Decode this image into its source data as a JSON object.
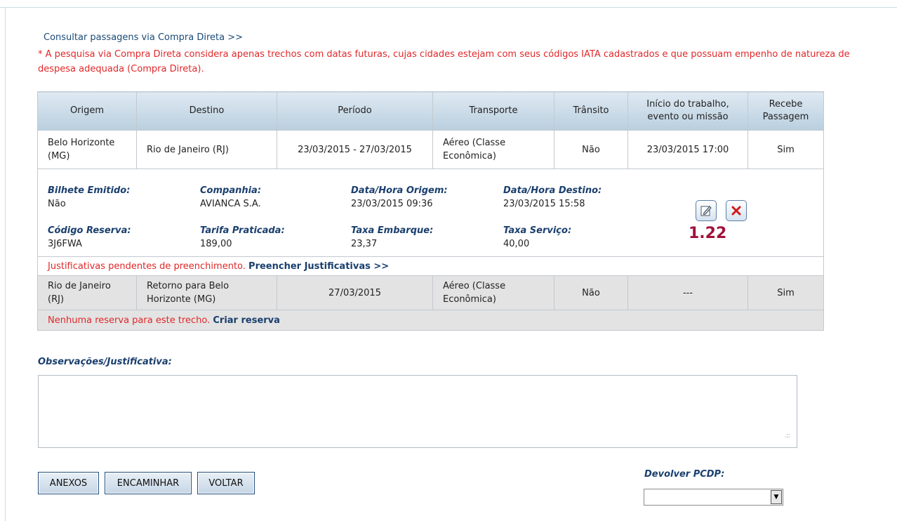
{
  "header": {
    "consult_link": "Consultar passagens via Compra Direta >>",
    "note": "* A pesquisa via Compra Direta considera apenas trechos com datas futuras, cujas cidades estejam com seus códigos IATA cadastrados e que possuam empenho de natureza de despesa adequada (Compra Direta)."
  },
  "table": {
    "headers": [
      "Origem",
      "Destino",
      "Período",
      "Transporte",
      "Trânsito",
      "Início do trabalho, evento ou missão",
      "Recebe Passagem"
    ],
    "rows": [
      {
        "origem": "Belo Horizonte (MG)",
        "destino": "Rio de Janeiro (RJ)",
        "periodo": "23/03/2015 - 27/03/2015",
        "transporte": "Aéreo (Classe Econômica)",
        "transito": "Não",
        "inicio": "23/03/2015 17:00",
        "recebe": "Sim"
      },
      {
        "origem": "Rio de Janeiro (RJ)",
        "destino": "Retorno para Belo Horizonte (MG)",
        "periodo": "27/03/2015",
        "transporte": "Aéreo (Classe Econômica)",
        "transito": "Não",
        "inicio": "---",
        "recebe": "Sim"
      }
    ],
    "detail": {
      "bilhete_label": "Bilhete Emitido:",
      "bilhete": "Não",
      "companhia_label": "Companhia:",
      "companhia": "AVIANCA S.A.",
      "data_origem_label": "Data/Hora Origem:",
      "data_origem": "23/03/2015 09:36",
      "data_destino_label": "Data/Hora Destino:",
      "data_destino": "23/03/2015 15:58",
      "codigo_label": "Código Reserva:",
      "codigo": "3J6FWA",
      "tarifa_label": "Tarifa Praticada:",
      "tarifa": "189,00",
      "taxa_embarque_label": "Taxa Embarque:",
      "taxa_embarque": "23,37",
      "taxa_servico_label": "Taxa Serviço:",
      "taxa_servico": "40,00",
      "version": "1.22",
      "edit_icon": "edit-icon",
      "delete_icon": "delete-icon"
    },
    "pending_text": "Justificativas pendentes de preenchimento.",
    "pending_link": "Preencher Justificativas >>",
    "no_reserve_text": "Nenhuma reserva para este trecho.",
    "no_reserve_link": "Criar reserva"
  },
  "observacoes": {
    "label": "Observações/Justificativa:",
    "value": ""
  },
  "buttons": {
    "anexos": "ANEXOS",
    "encaminhar": "ENCAMINHAR",
    "voltar": "VOLTAR"
  },
  "devolver": {
    "label": "Devolver PCDP:",
    "selected": ""
  },
  "colors": {
    "accent_blue": "#1a3f6e",
    "warning_red": "#e0282a",
    "version_red": "#a1123a"
  }
}
